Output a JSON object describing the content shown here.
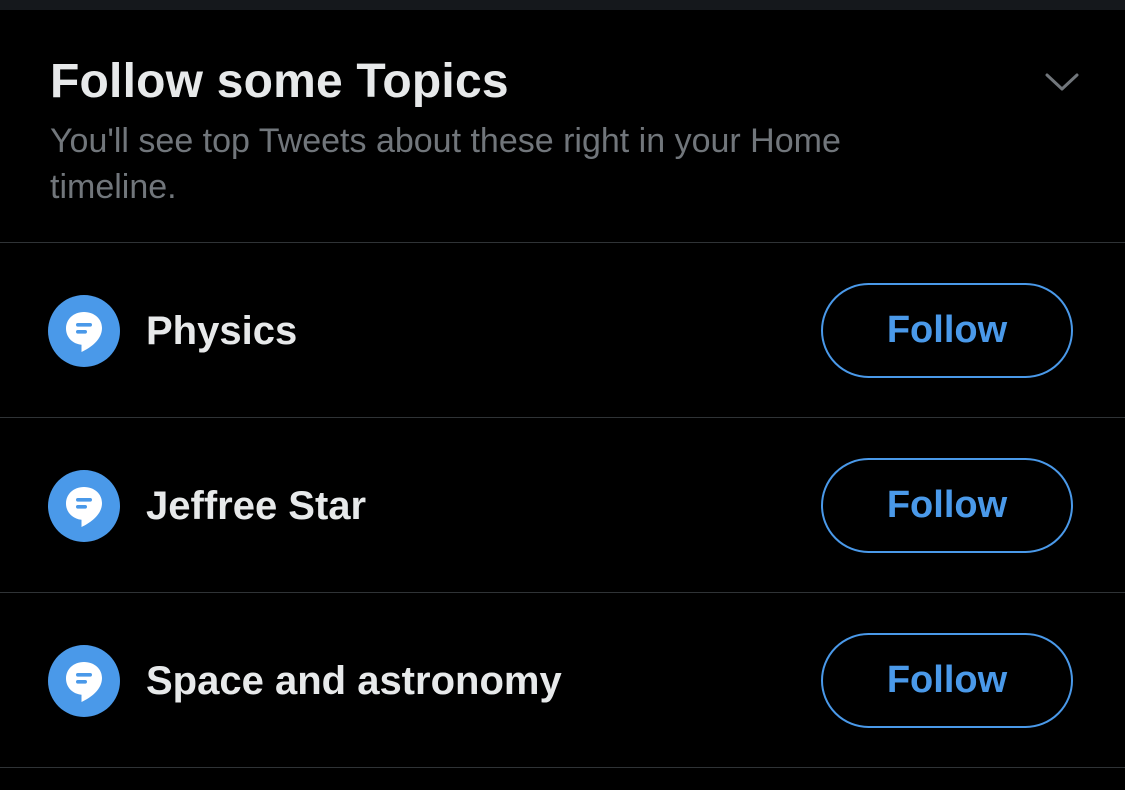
{
  "header": {
    "title": "Follow some Topics",
    "subtitle": "You'll see top Tweets about these right in your Home timeline.",
    "collapse_icon": "chevron-down-icon"
  },
  "topics": [
    {
      "label": "Physics",
      "icon": "topic-bubble-icon",
      "button_label": "Follow"
    },
    {
      "label": "Jeffree Star",
      "icon": "topic-bubble-icon",
      "button_label": "Follow"
    },
    {
      "label": "Space and astronomy",
      "icon": "topic-bubble-icon",
      "button_label": "Follow"
    }
  ],
  "colors": {
    "background": "#000000",
    "accent": "#4a99e9",
    "text_primary": "#e7e9ea",
    "text_secondary": "#71767b",
    "divider": "#2f3336"
  }
}
